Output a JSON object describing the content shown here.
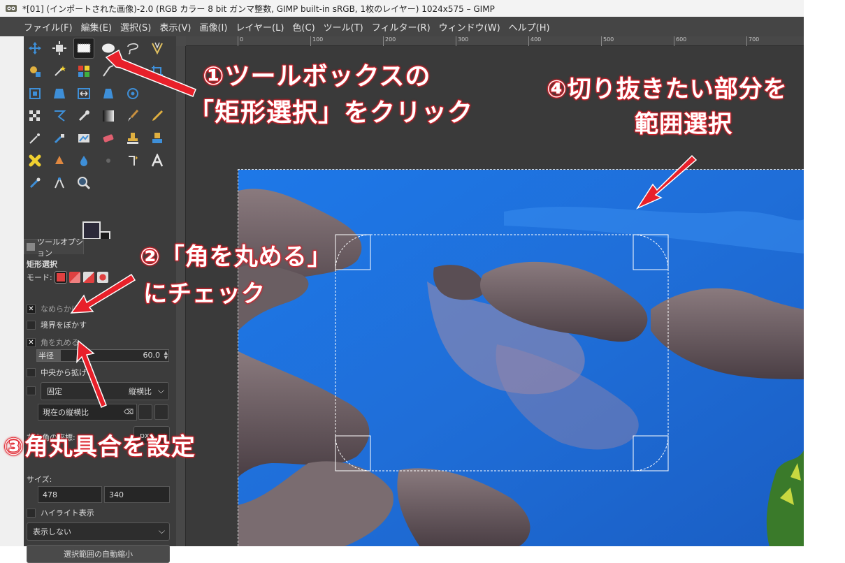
{
  "window": {
    "title": "*[01] (インポートされた画像)-2.0 (RGB カラー 8 bit ガンマ整数, GIMP built-in sRGB, 1枚のレイヤー) 1024x575 – GIMP"
  },
  "menubar": [
    "ファイル(F)",
    "編集(E)",
    "選択(S)",
    "表示(V)",
    "画像(I)",
    "レイヤー(L)",
    "色(C)",
    "ツール(T)",
    "フィルター(R)",
    "ウィンドウ(W)",
    "ヘルプ(H)"
  ],
  "toolbox": {
    "active_tool": "rect-select-tool"
  },
  "tool_options": {
    "tab_label": "ツールオプション",
    "title": "矩形選択",
    "mode_label": "モード:",
    "antialias_label": "なめらかに",
    "antialias_checked": true,
    "feather_label": "境界をぼかす",
    "feather_checked": false,
    "rounded_label": "角を丸める",
    "rounded_checked": true,
    "radius_label": "半径",
    "radius_value": "60.0",
    "expand_center_label": "中央から拡げ",
    "fixed_label": "固定",
    "fixed_combo": "縦横比",
    "aspect_entry": "現在の縦横比",
    "position_label": "左上角の座標:",
    "unit": "px",
    "size_label": "サイズ:",
    "width_value": "478",
    "height_value": "340",
    "highlight_label": "ハイライト表示",
    "guides_combo": "表示しない",
    "auto_shrink_button": "選択範囲の自動縮小"
  },
  "ruler": {
    "labels": [
      "0",
      "100",
      "200",
      "300",
      "400",
      "500",
      "600",
      "700",
      "800"
    ]
  },
  "annotations": {
    "step1_line1": "①ツールボックスの",
    "step1_line2": "「矩形選択」をクリック",
    "step2_line1": "②「角を丸める」",
    "step2_line2": "にチェック",
    "step3": "③角丸具合を設定",
    "step4_line1": "④切り抜きたい部分を",
    "step4_line2": "範囲選択"
  }
}
